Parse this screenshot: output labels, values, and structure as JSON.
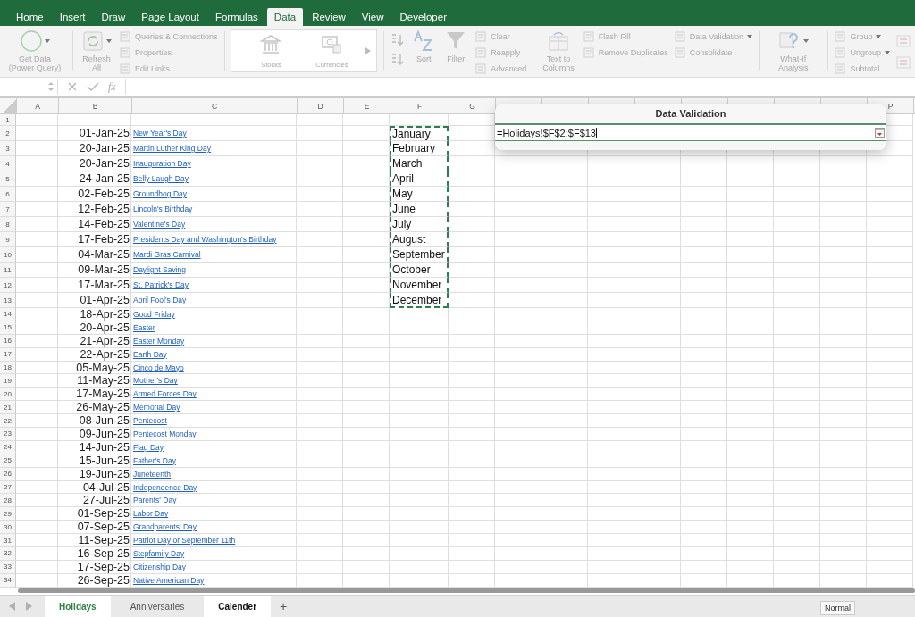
{
  "ribbon": {
    "tabs": [
      {
        "label": "Home",
        "selected": false
      },
      {
        "label": "Insert",
        "selected": false
      },
      {
        "label": "Draw",
        "selected": false
      },
      {
        "label": "Page Layout",
        "selected": false
      },
      {
        "label": "Formulas",
        "selected": false
      },
      {
        "label": "Data",
        "selected": true
      },
      {
        "label": "Review",
        "selected": false
      },
      {
        "label": "View",
        "selected": false
      },
      {
        "label": "Developer",
        "selected": false
      }
    ],
    "groups": [
      {
        "items": [
          {
            "kind": "large",
            "label": "Get Data (Power Query)",
            "dropdown": true,
            "disabled": true
          }
        ]
      },
      {
        "items": [
          {
            "kind": "large",
            "label": "Refresh All",
            "dropdown": true,
            "disabled": true
          },
          {
            "kind": "stack",
            "entries": [
              {
                "label": "Queries & Connections",
                "dropdown": false,
                "disabled": true
              },
              {
                "label": "Properties",
                "dropdown": false,
                "disabled": true
              },
              {
                "label": "Edit Links",
                "dropdown": false,
                "disabled": true
              }
            ]
          }
        ]
      },
      {
        "items": [
          {
            "kind": "gallery",
            "entries": [
              {
                "label": "Stocks",
                "disabled": true
              },
              {
                "label": "Currencies",
                "disabled": true
              }
            ]
          }
        ]
      },
      {
        "items": [
          {
            "kind": "sort"
          },
          {
            "kind": "large",
            "label": "Sort",
            "dropdown": false,
            "disabled": true
          },
          {
            "kind": "large",
            "label": "Filter",
            "dropdown": false,
            "disabled": true
          },
          {
            "kind": "stack",
            "entries": [
              {
                "label": "Clear",
                "dropdown": false,
                "disabled": true
              },
              {
                "label": "Reapply",
                "dropdown": false,
                "disabled": true
              },
              {
                "label": "Advanced",
                "dropdown": false,
                "disabled": true
              }
            ]
          }
        ]
      },
      {
        "items": [
          {
            "kind": "large",
            "label": "Text to Columns",
            "dropdown": false,
            "disabled": true
          },
          {
            "kind": "stack",
            "entries": [
              {
                "label": "Flash Fill",
                "dropdown": false,
                "disabled": true
              },
              {
                "label": "Remove Duplicates",
                "dropdown": false,
                "disabled": true
              }
            ]
          },
          {
            "kind": "stack",
            "entries": [
              {
                "label": "Data Validation",
                "dropdown": true,
                "disabled": true
              },
              {
                "label": "Consolidate",
                "dropdown": false,
                "disabled": true
              }
            ]
          }
        ]
      },
      {
        "items": [
          {
            "kind": "large",
            "label": "What-If Analysis",
            "dropdown": true,
            "disabled": true
          }
        ]
      },
      {
        "items": [
          {
            "kind": "stack",
            "entries": [
              {
                "label": "Group",
                "dropdown": true,
                "disabled": true
              },
              {
                "label": "Ungroup",
                "dropdown": true,
                "disabled": true
              },
              {
                "label": "Subtotal",
                "dropdown": false,
                "disabled": true
              }
            ]
          },
          {
            "kind": "icons"
          }
        ]
      }
    ]
  },
  "formula_bar": {
    "fx_label": "fx"
  },
  "sheet": {
    "columns": [
      {
        "label": "A"
      },
      {
        "label": "B"
      },
      {
        "label": "C"
      },
      {
        "label": "D"
      },
      {
        "label": "E"
      },
      {
        "label": "F"
      },
      {
        "label": "G"
      },
      {},
      {},
      {},
      {},
      {},
      {},
      {},
      {},
      {
        "label": "P"
      }
    ],
    "rows": [
      {
        "num": "1",
        "in_copy_range": false
      },
      {
        "num": "2",
        "date": "01-Jan-25",
        "holiday": "New Year's Day",
        "month": "January",
        "in_copy_range": true
      },
      {
        "num": "3",
        "date": "20-Jan-25",
        "holiday": "Martin Luther King Day",
        "month": "February",
        "in_copy_range": true
      },
      {
        "num": "4",
        "date": "20-Jan-25",
        "holiday": "Inauguration Day",
        "month": "March",
        "in_copy_range": true
      },
      {
        "num": "5",
        "date": "24-Jan-25",
        "holiday": "Belly Laugh Day",
        "month": "April",
        "in_copy_range": true
      },
      {
        "num": "6",
        "date": "02-Feb-25",
        "holiday": "Groundhog Day",
        "month": "May",
        "in_copy_range": true
      },
      {
        "num": "7",
        "date": "12-Feb-25",
        "holiday": "Lincoln's Birthday",
        "month": "June",
        "in_copy_range": true
      },
      {
        "num": "8",
        "date": "14-Feb-25",
        "holiday": "Valentine's Day",
        "month": "July",
        "in_copy_range": true
      },
      {
        "num": "9",
        "date": "17-Feb-25",
        "holiday": "Presidents Day and Washington's Birthday",
        "month": "August",
        "in_copy_range": true
      },
      {
        "num": "10",
        "date": "04-Mar-25",
        "holiday": "Mardi Gras Carnival",
        "month": "September",
        "in_copy_range": true
      },
      {
        "num": "11",
        "date": "09-Mar-25",
        "holiday": "Daylight Saving",
        "month": "October",
        "in_copy_range": true
      },
      {
        "num": "12",
        "date": "17-Mar-25",
        "holiday": "St. Patrick's Day",
        "month": "November",
        "in_copy_range": true
      },
      {
        "num": "13",
        "date": "01-Apr-25",
        "holiday": "April Fool's Day",
        "month": "December",
        "in_copy_range": true
      },
      {
        "num": "14",
        "date": "18-Apr-25",
        "holiday": "Good Friday",
        "in_copy_range": false
      },
      {
        "num": "15",
        "date": "20-Apr-25",
        "holiday": "Easter",
        "in_copy_range": false
      },
      {
        "num": "16",
        "date": "21-Apr-25",
        "holiday": "Easter Monday",
        "in_copy_range": false
      },
      {
        "num": "17",
        "date": "22-Apr-25",
        "holiday": "Earth Day",
        "in_copy_range": false
      },
      {
        "num": "18",
        "date": "05-May-25",
        "holiday": "Cinco de Mayo",
        "in_copy_range": false
      },
      {
        "num": "19",
        "date": "11-May-25",
        "holiday": "Mother's Day",
        "in_copy_range": false
      },
      {
        "num": "20",
        "date": "17-May-25",
        "holiday": "Armed Forces Day",
        "in_copy_range": false
      },
      {
        "num": "21",
        "date": "26-May-25",
        "holiday": "Memorial Day",
        "in_copy_range": false
      },
      {
        "num": "22",
        "date": "08-Jun-25",
        "holiday": "Pentecost",
        "in_copy_range": false
      },
      {
        "num": "23",
        "date": "09-Jun-25",
        "holiday": "Pentecost Monday",
        "in_copy_range": false
      },
      {
        "num": "24",
        "date": "14-Jun-25",
        "holiday": "Flag Day",
        "in_copy_range": false
      },
      {
        "num": "25",
        "date": "15-Jun-25",
        "holiday": "Father's Day",
        "in_copy_range": false
      },
      {
        "num": "26",
        "date": "19-Jun-25",
        "holiday": "Juneteenth",
        "in_copy_range": false
      },
      {
        "num": "27",
        "date": "04-Jul-25",
        "holiday": "Independence Day",
        "in_copy_range": false
      },
      {
        "num": "28",
        "date": "27-Jul-25",
        "holiday": "Parents' Day",
        "in_copy_range": false
      },
      {
        "num": "29",
        "date": "01-Sep-25",
        "holiday": "Labor Day",
        "in_copy_range": false
      },
      {
        "num": "30",
        "date": "07-Sep-25",
        "holiday": "Grandparents' Day",
        "in_copy_range": false
      },
      {
        "num": "31",
        "date": "11-Sep-25",
        "holiday": "Patriot Day or September 11th",
        "in_copy_range": false
      },
      {
        "num": "32",
        "date": "16-Sep-25",
        "holiday": "Stepfamily Day",
        "in_copy_range": false
      },
      {
        "num": "33",
        "date": "17-Sep-25",
        "holiday": "Citizenship Day",
        "in_copy_range": false
      },
      {
        "num": "34",
        "date": "26-Sep-25",
        "holiday": "Native American Day",
        "in_copy_range": false
      }
    ]
  },
  "dialog": {
    "title": "Data Validation",
    "value": "=Holidays!$F$2:$F$13"
  },
  "sheet_tabs": {
    "tabs": [
      {
        "label": "Holidays",
        "selected": true,
        "highlighted": false
      },
      {
        "label": "Anniversaries",
        "selected": false,
        "highlighted": false
      },
      {
        "label": "Calender",
        "selected": false,
        "highlighted": true
      }
    ],
    "add_label": "+"
  },
  "tooltip": "Normal"
}
